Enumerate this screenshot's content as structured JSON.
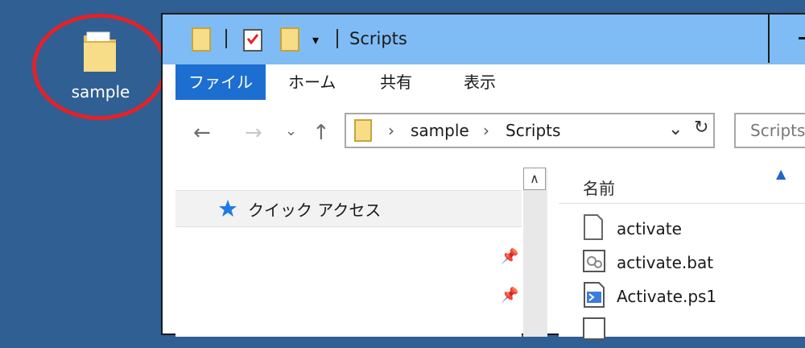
{
  "desktop": {
    "icon_label": "sample"
  },
  "window": {
    "title": "Scripts",
    "ribbon_tabs": [
      "ファイル",
      "ホーム",
      "共有",
      "表示"
    ]
  },
  "address": {
    "crumbs": [
      "sample",
      "Scripts"
    ],
    "search_placeholder": "Scripts"
  },
  "navpane": {
    "quick_access": "クイック アクセス"
  },
  "content": {
    "column_name": "名前",
    "files": [
      {
        "name": "activate",
        "icon": "blank-file-icon"
      },
      {
        "name": "activate.bat",
        "icon": "batch-file-icon"
      },
      {
        "name": "Activate.ps1",
        "icon": "powershell-file-icon"
      }
    ]
  }
}
